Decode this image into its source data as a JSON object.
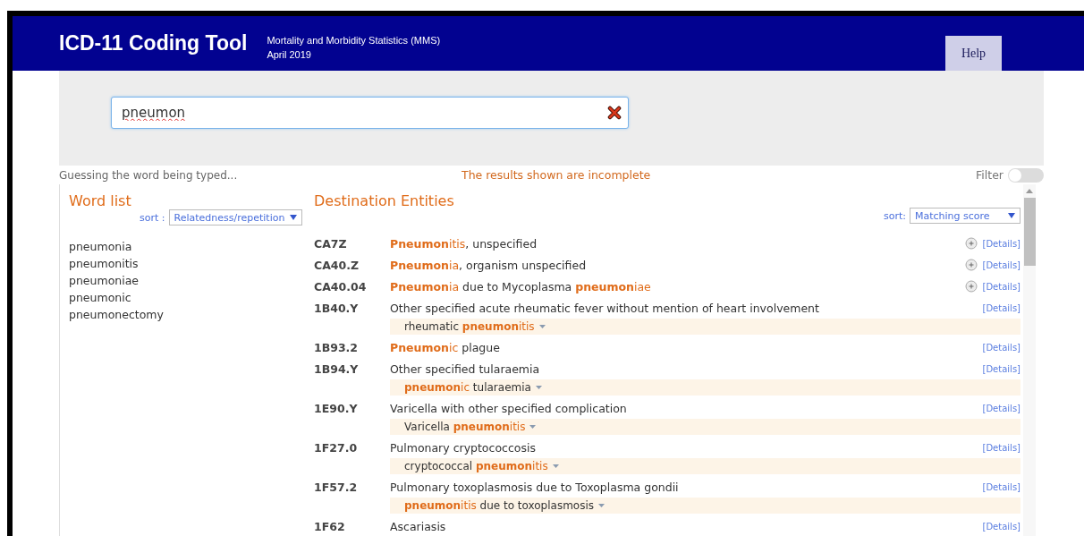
{
  "header": {
    "title": "ICD-11 Coding Tool",
    "subtitle_lines": [
      "Mortality and Morbidity Statistics (MMS)",
      "April 2019"
    ],
    "help_button": "Help"
  },
  "search": {
    "value": "pneumon"
  },
  "status": {
    "guess": "Guessing the word being typed...",
    "warning": "The results shown are incomplete",
    "filter_label": "Filter",
    "filter_on": false
  },
  "word_list": {
    "heading": "Word list",
    "sort_label": "sort :",
    "sort_value": "Relatedness/repetition",
    "words": [
      "pneumonia",
      "pneumonitis",
      "pneumoniae",
      "pneumonic",
      "pneumonectomy"
    ]
  },
  "destination": {
    "heading": "Destination Entities",
    "sort_label": "sort:",
    "sort_value": "Matching score",
    "results": [
      {
        "code": "CA7Z",
        "expandable": true,
        "details": "[Details]",
        "title": [
          {
            "kind": "match",
            "text": "Pneumon"
          },
          {
            "kind": "partial",
            "text": "itis"
          },
          {
            "kind": "plain",
            "text": ", unspecified"
          }
        ]
      },
      {
        "code": "CA40.Z",
        "expandable": true,
        "details": "[Details]",
        "title": [
          {
            "kind": "match",
            "text": "Pneumon"
          },
          {
            "kind": "partial",
            "text": "ia"
          },
          {
            "kind": "plain",
            "text": ", organism unspecified"
          }
        ]
      },
      {
        "code": "CA40.04",
        "expandable": true,
        "details": "[Details]",
        "title": [
          {
            "kind": "match",
            "text": "Pneumon"
          },
          {
            "kind": "partial",
            "text": "ia"
          },
          {
            "kind": "plain",
            "text": " due to Mycoplasma "
          },
          {
            "kind": "match",
            "text": "pneumon"
          },
          {
            "kind": "partial",
            "text": "iae"
          }
        ]
      },
      {
        "code": "1B40.Y",
        "expandable": false,
        "details": "[Details]",
        "title": [
          {
            "kind": "plain",
            "text": "Other specified acute rheumatic fever without mention of heart involvement"
          }
        ],
        "synonym": [
          {
            "kind": "plain",
            "text": "rheumatic "
          },
          {
            "kind": "match",
            "text": "pneumon"
          },
          {
            "kind": "partial",
            "text": "itis"
          }
        ]
      },
      {
        "code": "1B93.2",
        "expandable": false,
        "details": "[Details]",
        "title": [
          {
            "kind": "match",
            "text": "Pneumon"
          },
          {
            "kind": "partial",
            "text": "ic"
          },
          {
            "kind": "plain",
            "text": " plague"
          }
        ]
      },
      {
        "code": "1B94.Y",
        "expandable": false,
        "details": "[Details]",
        "title": [
          {
            "kind": "plain",
            "text": "Other specified tularaemia"
          }
        ],
        "synonym": [
          {
            "kind": "match",
            "text": "pneumon"
          },
          {
            "kind": "partial",
            "text": "ic"
          },
          {
            "kind": "plain",
            "text": " tularaemia"
          }
        ]
      },
      {
        "code": "1E90.Y",
        "expandable": false,
        "details": "[Details]",
        "title": [
          {
            "kind": "plain",
            "text": "Varicella with other specified complication"
          }
        ],
        "synonym": [
          {
            "kind": "plain",
            "text": "Varicella "
          },
          {
            "kind": "match",
            "text": "pneumon"
          },
          {
            "kind": "partial",
            "text": "itis"
          }
        ]
      },
      {
        "code": "1F27.0",
        "expandable": false,
        "details": "[Details]",
        "title": [
          {
            "kind": "plain",
            "text": "Pulmonary cryptococcosis"
          }
        ],
        "synonym": [
          {
            "kind": "plain",
            "text": "cryptococcal "
          },
          {
            "kind": "match",
            "text": "pneumon"
          },
          {
            "kind": "partial",
            "text": "itis"
          }
        ]
      },
      {
        "code": "1F57.2",
        "expandable": false,
        "details": "[Details]",
        "title": [
          {
            "kind": "plain",
            "text": "Pulmonary toxoplasmosis due to Toxoplasma gondii"
          }
        ],
        "synonym": [
          {
            "kind": "match",
            "text": "pneumon"
          },
          {
            "kind": "partial",
            "text": "itis"
          },
          {
            "kind": "plain",
            "text": " due to toxoplasmosis"
          }
        ]
      },
      {
        "code": "1F62",
        "expandable": false,
        "details": "[Details]",
        "title": [
          {
            "kind": "plain",
            "text": "Ascariasis"
          }
        ]
      }
    ]
  }
}
